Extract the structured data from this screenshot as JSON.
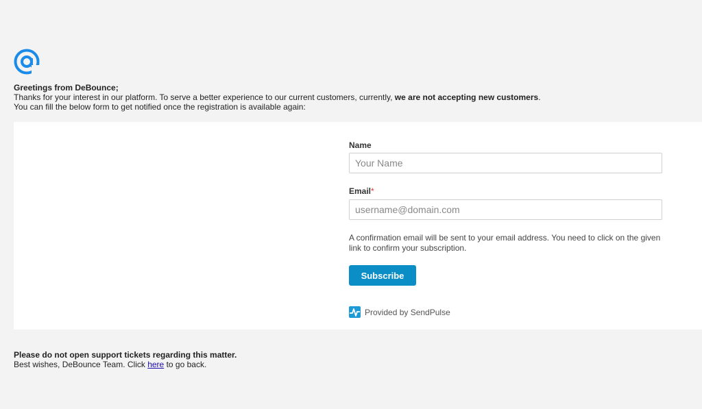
{
  "brand": {
    "logo_icon": "at-sign-icon",
    "accent_color": "#0b8ec5"
  },
  "intro": {
    "greeting": "Greetings from DeBounce;",
    "line1_prefix": "Thanks for your interest in our platform. To serve a better experience to our current customers, currently, ",
    "line1_bold": "we are not accepting new customers",
    "line1_suffix": ".",
    "line2": "You can fill the below form to get notified once the registration is available again:"
  },
  "form": {
    "name_label": "Name",
    "name_placeholder": "Your Name",
    "email_label": "Email",
    "email_required_mark": "*",
    "email_placeholder": "username@domain.com",
    "note": "A confirmation email will be sent to your email address. You need to click on the given link to confirm your subscription.",
    "subscribe_label": "Subscribe",
    "provided_by": "Provided by SendPulse",
    "provided_icon": "sendpulse-logo-icon"
  },
  "footer": {
    "warning": "Please do not open support tickets regarding this matter.",
    "signoff_prefix": "Best wishes, DeBounce Team. Click ",
    "link_text": "here",
    "signoff_suffix": " to go back."
  }
}
